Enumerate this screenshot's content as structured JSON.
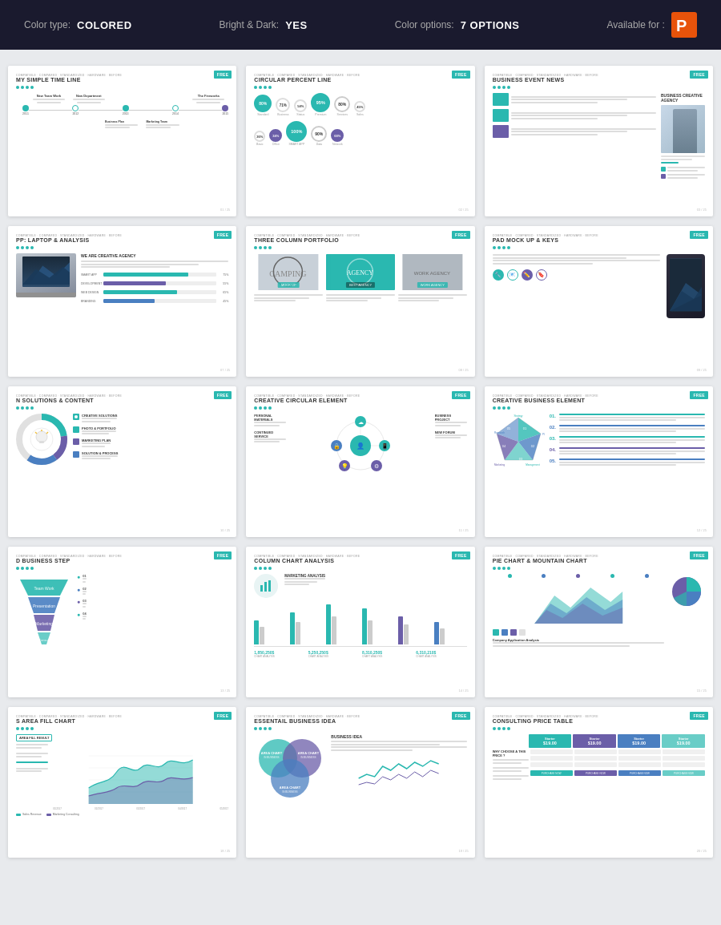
{
  "topbar": {
    "color_type_label": "Color type:",
    "color_type_value": "COLORED",
    "bright_dark_label": "Bright & Dark:",
    "bright_dark_value": "YES",
    "color_options_label": "Color options:",
    "color_options_value": "7 OPTIONS",
    "available_label": "Available for :",
    "brand_color": "#e8530a"
  },
  "slides": [
    {
      "id": 1,
      "badge": "FREE",
      "top_label": "COMPATIBLE COMPARED STANDARDIZED HARDWARE BEFORE",
      "title": "MY SIMPLE TIME LINE",
      "years": [
        "2011",
        "2012",
        "2013",
        "2014",
        "2015"
      ],
      "labels": [
        "New Team Work",
        "New Department",
        "The Fireworks"
      ]
    },
    {
      "id": 2,
      "badge": "FREE",
      "top_label": "COMPATIBLE COMPARED STANDARDIZED HARDWARE BEFORE",
      "title": "CIRCULAR PERCENT LINE",
      "percents": [
        "80%",
        "71%",
        "54%",
        "95%",
        "80%",
        "45%",
        "36%",
        "34%",
        "100%",
        "90%",
        "68%"
      ]
    },
    {
      "id": 3,
      "badge": "FREE",
      "top_label": "COMPATIBLE COMPARED STANDARDIZED HARDWARE BEFORE",
      "title": "BUSINESS EVENT NEWS",
      "subtitle": "BUSINESS CREATIVE AGENCY"
    },
    {
      "id": 4,
      "badge": "FREE",
      "top_label": "COMPATIBLE COMPARED STANDARDIZED HARDWARE BEFORE",
      "title": "PP: LAPTOP & ANALYSIS",
      "bars": [
        {
          "label": "SMART APP",
          "value": 75,
          "color": "#2ab8b0"
        },
        {
          "label": "DEVELOPMENT",
          "value": 55,
          "color": "#6b5ea8"
        },
        {
          "label": "WEB DESIGN",
          "value": 65,
          "color": "#2ab8b0"
        },
        {
          "label": "BRANDING",
          "value": 45,
          "color": "#4a7fc1"
        }
      ]
    },
    {
      "id": 5,
      "badge": "FREE",
      "top_label": "COMPATIBLE COMPARED STANDARDIZED HARDWARE BEFORE",
      "title": "THREE COLUMN PORTFOLIO",
      "cols": [
        "MOCK UP",
        "BEST AGENCY",
        "WORK AGENCY"
      ]
    },
    {
      "id": 6,
      "badge": "FREE",
      "top_label": "COMPATIBLE COMPARED STANDARDIZED HARDWARE BEFORE",
      "title": "PAD MOCK UP & KEYS",
      "icons": [
        "🔧",
        "📧",
        "✏️",
        "🔖"
      ]
    },
    {
      "id": 7,
      "badge": "FREE",
      "top_label": "COMPATIBLE COMPARED STANDARDIZED HARDWARE BEFORE",
      "title": "N SOLUTIONS & CONTENT",
      "solutions": [
        "CREATIVE SOLUTIONS",
        "PHOTO & PORTFOLIO",
        "MARKETING PLAN",
        "SOLUTION & PROCESS"
      ]
    },
    {
      "id": 8,
      "badge": "FREE",
      "top_label": "COMPATIBLE COMPARED STANDARDIZED HARDWARE BEFORE",
      "title": "CREATIVE CIRCULAR ELEMENT",
      "items": [
        "PERSONAL MATERIALS",
        "BUSINESS PROJECT",
        "CONTINUED SERVICE",
        "NEW FORUM"
      ]
    },
    {
      "id": 9,
      "badge": "FREE",
      "top_label": "COMPATIBLE COMPARED STANDARDIZED HARDWARE BEFORE",
      "title": "CREATIVE BUSINESS ELEMENT",
      "items": [
        "01",
        "02",
        "03",
        "04",
        "05"
      ]
    },
    {
      "id": 10,
      "badge": "FREE",
      "top_label": "COMPATIBLE COMPARED STANDARDIZED HARDWARE BEFORE",
      "title": "D BUSINESS STEP",
      "steps": [
        "Team Work",
        "Presentation Project",
        "Marketing Team",
        "Business Consulting"
      ]
    },
    {
      "id": 11,
      "badge": "FREE",
      "top_label": "COMPATIBLE COMPARED STANDARDIZED HARDWARE BEFORE",
      "title": "COLUMN CHART ANALYSIS",
      "stats": [
        "1,850,250$",
        "5,250,250$",
        "8,310,250$",
        "6,310,210$"
      ]
    },
    {
      "id": 12,
      "badge": "FREE",
      "top_label": "COMPATIBLE COMPARED STANDARDIZED HARDWARE BEFORE",
      "title": "PIE CHART & MOUNTAIN CHART",
      "subtitle": "Company Application Analysis"
    },
    {
      "id": 13,
      "badge": "FREE",
      "top_label": "COMPATIBLE COMPARED STANDARDIZED HARDWARE BEFORE",
      "title": "S AREA FILL CHART",
      "legends": [
        "Sales Revenue",
        "Marketing Consulting"
      ]
    },
    {
      "id": 14,
      "badge": "FREE",
      "top_label": "COMPATIBLE COMPARED STANDARDIZED HARDWARE BEFORE",
      "title": "ESSENTAIL BUSINESS IDEA",
      "subtitle": "BUSINESS IDEA"
    },
    {
      "id": 15,
      "badge": "FREE",
      "top_label": "COMPATIBLE COMPARED STANDARDIZED HARDWARE BEFORE",
      "title": "CONSULTING PRICE TABLE",
      "tiers": [
        "Starter",
        "Starter",
        "Starter",
        "Starter"
      ],
      "prices": [
        "$19.00",
        "$19.00",
        "$19.00",
        "$19.00"
      ],
      "cta": "WHY CHOOSE A THIS PRICE ?"
    }
  ]
}
